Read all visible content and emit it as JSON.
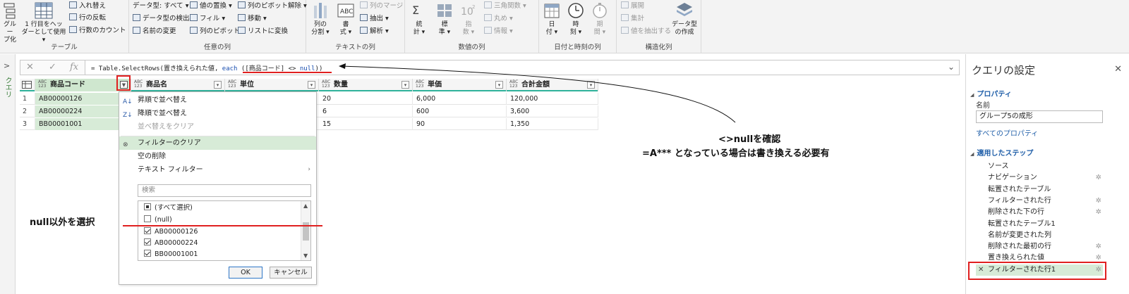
{
  "ribbon": {
    "groups": [
      {
        "label": "テーブル"
      },
      {
        "label": "任意の列"
      },
      {
        "label": "テキストの列"
      },
      {
        "label": "数値の列"
      },
      {
        "label": "日付と時刻の列"
      },
      {
        "label": "構造化列"
      }
    ],
    "table": {
      "group_label_1": "グルー",
      "group_label_2": "プ化",
      "first_row_1": "1 行目をヘッ",
      "first_row_2": "ダーとして使用 ▾",
      "transpose": "入れ替え",
      "reverse_rows": "行の反転",
      "count_rows": "行数のカウント"
    },
    "anycol": {
      "data_type": "データ型: すべて ▾",
      "detect_type": "データ型の検出",
      "rename": "名前の変更",
      "replace_values": "値の置換 ▾",
      "fill": "フィル ▾",
      "pivot": "列のピボット",
      "unpivot": "列のピボット解除 ▾",
      "move": "移動 ▾",
      "to_list": "リストに変換"
    },
    "textcol": {
      "split_1": "列の",
      "split_2": "分割 ▾",
      "format_1": "書",
      "format_2": "式 ▾",
      "merge": "列のマージ",
      "extract": "抽出 ▾",
      "parse": "解析 ▾"
    },
    "numcol": {
      "stats_1": "統",
      "stats_2": "計 ▾",
      "standard_1": "標",
      "standard_2": "準 ▾",
      "sci_1": "指",
      "sci_2": "数 ▾",
      "trig": "三角関数 ▾",
      "round": "丸め ▾",
      "info": "情報 ▾"
    },
    "datecol": {
      "date_1": "日",
      "date_2": "付 ▾",
      "time_1": "時",
      "time_2": "刻 ▾",
      "duration_1": "期",
      "duration_2": "間 ▾"
    },
    "structcol": {
      "expand": "展開",
      "aggregate": "集計",
      "extract_values": "値を抽出する",
      "datatype_create_1": "データ型",
      "datatype_create_2": "の作成"
    }
  },
  "leftpane": {
    "label": "クエリ"
  },
  "formula": {
    "prefix": "= Table.SelectRows(置き換えられた値, ",
    "keyword": "each",
    "condition": " ([商品コード] <> ",
    "null_kw": "null",
    "suffix": "))"
  },
  "grid": {
    "columns": [
      {
        "name": "商品コード",
        "type_top": "ABC",
        "type_bottom": "123"
      },
      {
        "name": "商品名",
        "type_top": "ABC",
        "type_bottom": "123"
      },
      {
        "name": "単位",
        "type_top": "ABC",
        "type_bottom": "123"
      },
      {
        "name": "数量",
        "type_top": "ABC",
        "type_bottom": "123"
      },
      {
        "name": "単価",
        "type_top": "ABC",
        "type_bottom": "123"
      },
      {
        "name": "合計金額",
        "type_top": "ABC",
        "type_bottom": "123"
      }
    ],
    "rows": [
      {
        "n": "1",
        "code": "AB00000126",
        "qty": "20",
        "price": "6,000",
        "total": "120,000"
      },
      {
        "n": "2",
        "code": "AB00000224",
        "qty": "6",
        "price": "600",
        "total": "3,600"
      },
      {
        "n": "3",
        "code": "BB00001001",
        "qty": "15",
        "price": "90",
        "total": "1,350"
      }
    ]
  },
  "menu": {
    "sort_asc": "昇順で並べ替え",
    "sort_desc": "降順で並べ替え",
    "clear_sort": "並べ替えをクリア",
    "clear_filter": "フィルターのクリア",
    "remove_empty": "空の削除",
    "text_filters": "テキスト フィルター",
    "search_placeholder": "検索",
    "items": [
      {
        "label": "(すべて選択)"
      },
      {
        "label": "(null)"
      },
      {
        "label": "AB00000126"
      },
      {
        "label": "AB00000224"
      },
      {
        "label": "BB00001001"
      }
    ],
    "ok": "OK",
    "cancel": "キャンセル"
  },
  "annotations": {
    "null_select": "null以外を選択",
    "confirm_line1": "<>nullを確認",
    "confirm_line2": "=A*** となっている場合は書き換える必要有"
  },
  "settings": {
    "title": "クエリの設定",
    "properties": "プロパティ",
    "name_label": "名前",
    "name_value": "グループ5の成形",
    "all_properties": "すべてのプロパティ",
    "applied_steps": "適用したステップ",
    "steps": [
      {
        "label": "ソース"
      },
      {
        "label": "ナビゲーション"
      },
      {
        "label": "転置されたテーブル"
      },
      {
        "label": "フィルターされた行"
      },
      {
        "label": "削除された下の行"
      },
      {
        "label": "転置されたテーブル1"
      },
      {
        "label": "名前が変更された列"
      },
      {
        "label": "削除された最初の行"
      },
      {
        "label": "置き換えられた値"
      },
      {
        "label": "フィルターされた行1"
      }
    ]
  },
  "colors": {
    "accent_green": "#2fb29b",
    "highlight": "#e02020",
    "selected_bg": "#d7ebd7",
    "link_blue": "#1f5ea8"
  }
}
